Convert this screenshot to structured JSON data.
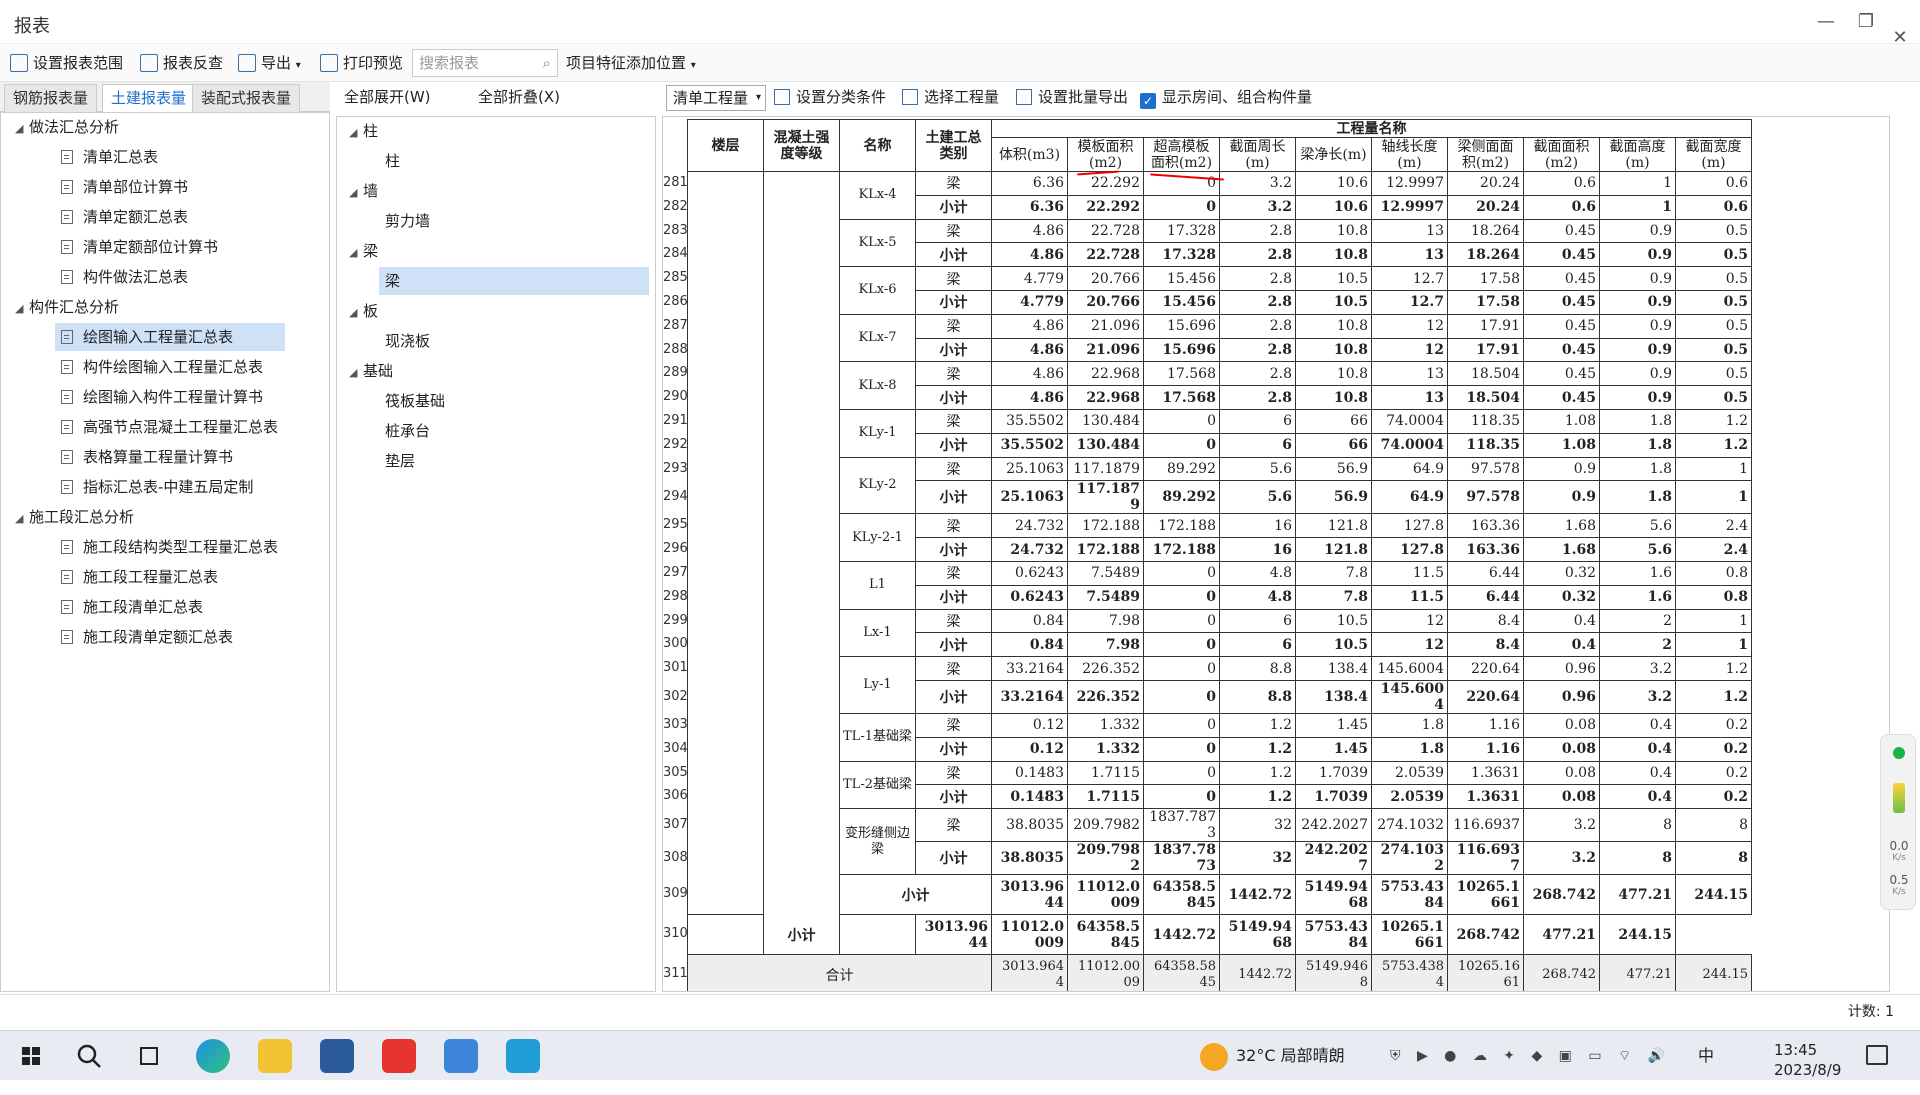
{
  "window": {
    "title": "报表",
    "min": "—",
    "restore": "❐",
    "close": "✕"
  },
  "toolbar": {
    "set_range": "设置报表范围",
    "reverse": "报表反查",
    "export": "导出",
    "print": "打印预览",
    "search_placeholder": "搜索报表",
    "feature": "项目特征添加位置"
  },
  "left_tabs": [
    "钢筋报表量",
    "土建报表量",
    "装配式报表量"
  ],
  "tree": [
    {
      "type": "group",
      "label": "做法汇总分析"
    },
    {
      "type": "item",
      "label": "清单汇总表"
    },
    {
      "type": "item",
      "label": "清单部位计算书"
    },
    {
      "type": "item",
      "label": "清单定额汇总表"
    },
    {
      "type": "item",
      "label": "清单定额部位计算书"
    },
    {
      "type": "item",
      "label": "构件做法汇总表"
    },
    {
      "type": "group",
      "label": "构件汇总分析"
    },
    {
      "type": "item",
      "label": "绘图输入工程量汇总表",
      "selected": true
    },
    {
      "type": "item",
      "label": "构件绘图输入工程量汇总表"
    },
    {
      "type": "item",
      "label": "绘图输入构件工程量计算书"
    },
    {
      "type": "item",
      "label": "高强节点混凝土工程量汇总表"
    },
    {
      "type": "item",
      "label": "表格算量工程量计算书"
    },
    {
      "type": "item",
      "label": "指标汇总表-中建五局定制"
    },
    {
      "type": "group",
      "label": "施工段汇总分析"
    },
    {
      "type": "item",
      "label": "施工段结构类型工程量汇总表"
    },
    {
      "type": "item",
      "label": "施工段工程量汇总表"
    },
    {
      "type": "item",
      "label": "施工段清单汇总表"
    },
    {
      "type": "item",
      "label": "施工段清单定额汇总表"
    }
  ],
  "mid": {
    "expand": "全部展开(W)",
    "collapse": "全部折叠(X)",
    "tree": [
      {
        "type": "group",
        "label": "柱"
      },
      {
        "type": "item",
        "label": "柱"
      },
      {
        "type": "group",
        "label": "墙"
      },
      {
        "type": "item",
        "label": "剪力墙"
      },
      {
        "type": "group",
        "label": "梁"
      },
      {
        "type": "item",
        "label": "梁",
        "selected": true
      },
      {
        "type": "group",
        "label": "板"
      },
      {
        "type": "item",
        "label": "现浇板"
      },
      {
        "type": "group",
        "label": "基础"
      },
      {
        "type": "item",
        "label": "筏板基础"
      },
      {
        "type": "item",
        "label": "桩承台"
      },
      {
        "type": "item",
        "label": "垫层"
      }
    ]
  },
  "right_toolbar": {
    "dropdown": "清单工程量",
    "classify": "设置分类条件",
    "select": "选择工程量",
    "batch": "设置批量导出",
    "show_rooms": "显示房间、组合构件量"
  },
  "table": {
    "headers": {
      "floor": "楼层",
      "grade": "混凝土强度等级",
      "name": "名称",
      "category": "土建工总类别",
      "group": "工程量名称",
      "cols": [
        "体积(m3)",
        "模板面积(m2)",
        "超高模板面积(m2)",
        "截面周长(m)",
        "梁净长(m)",
        "轴线长度(m)",
        "梁侧面面积(m2)",
        "截面面积(m2)",
        "截面高度(m)",
        "截面宽度(m)"
      ]
    },
    "rows": [
      {
        "no": "281",
        "name": "KLx-4",
        "cat": "梁",
        "v": [
          "6.36",
          "22.292",
          "0",
          "3.2",
          "10.6",
          "12.9997",
          "20.24",
          "0.6",
          "1",
          "0.6"
        ]
      },
      {
        "no": "282",
        "cat": "小计",
        "bold": true,
        "v": [
          "6.36",
          "22.292",
          "0",
          "3.2",
          "10.6",
          "12.9997",
          "20.24",
          "0.6",
          "1",
          "0.6"
        ]
      },
      {
        "no": "283",
        "name": "KLx-5",
        "cat": "梁",
        "v": [
          "4.86",
          "22.728",
          "17.328",
          "2.8",
          "10.8",
          "13",
          "18.264",
          "0.45",
          "0.9",
          "0.5"
        ]
      },
      {
        "no": "284",
        "cat": "小计",
        "bold": true,
        "v": [
          "4.86",
          "22.728",
          "17.328",
          "2.8",
          "10.8",
          "13",
          "18.264",
          "0.45",
          "0.9",
          "0.5"
        ]
      },
      {
        "no": "285",
        "name": "KLx-6",
        "cat": "梁",
        "v": [
          "4.779",
          "20.766",
          "15.456",
          "2.8",
          "10.5",
          "12.7",
          "17.58",
          "0.45",
          "0.9",
          "0.5"
        ]
      },
      {
        "no": "286",
        "cat": "小计",
        "bold": true,
        "v": [
          "4.779",
          "20.766",
          "15.456",
          "2.8",
          "10.5",
          "12.7",
          "17.58",
          "0.45",
          "0.9",
          "0.5"
        ]
      },
      {
        "no": "287",
        "name": "KLx-7",
        "cat": "梁",
        "v": [
          "4.86",
          "21.096",
          "15.696",
          "2.8",
          "10.8",
          "12",
          "17.91",
          "0.45",
          "0.9",
          "0.5"
        ]
      },
      {
        "no": "288",
        "cat": "小计",
        "bold": true,
        "v": [
          "4.86",
          "21.096",
          "15.696",
          "2.8",
          "10.8",
          "12",
          "17.91",
          "0.45",
          "0.9",
          "0.5"
        ]
      },
      {
        "no": "289",
        "name": "KLx-8",
        "cat": "梁",
        "v": [
          "4.86",
          "22.968",
          "17.568",
          "2.8",
          "10.8",
          "13",
          "18.504",
          "0.45",
          "0.9",
          "0.5"
        ]
      },
      {
        "no": "290",
        "cat": "小计",
        "bold": true,
        "v": [
          "4.86",
          "22.968",
          "17.568",
          "2.8",
          "10.8",
          "13",
          "18.504",
          "0.45",
          "0.9",
          "0.5"
        ]
      },
      {
        "no": "291",
        "name": "KLy-1",
        "cat": "梁",
        "v": [
          "35.5502",
          "130.484",
          "0",
          "6",
          "66",
          "74.0004",
          "118.35",
          "1.08",
          "1.8",
          "1.2"
        ]
      },
      {
        "no": "292",
        "cat": "小计",
        "bold": true,
        "v": [
          "35.5502",
          "130.484",
          "0",
          "6",
          "66",
          "74.0004",
          "118.35",
          "1.08",
          "1.8",
          "1.2"
        ]
      },
      {
        "no": "293",
        "name": "KLy-2",
        "cat": "梁",
        "v": [
          "25.1063",
          "117.1879",
          "89.292",
          "5.6",
          "56.9",
          "64.9",
          "97.578",
          "0.9",
          "1.8",
          "1"
        ]
      },
      {
        "no": "294",
        "cat": "小计",
        "bold": true,
        "v": [
          "25.1063",
          "117.1879",
          "89.292",
          "5.6",
          "56.9",
          "64.9",
          "97.578",
          "0.9",
          "1.8",
          "1"
        ]
      },
      {
        "no": "295",
        "name": "KLy-2-1",
        "cat": "梁",
        "v": [
          "24.732",
          "172.188",
          "172.188",
          "16",
          "121.8",
          "127.8",
          "163.36",
          "1.68",
          "5.6",
          "2.4"
        ]
      },
      {
        "no": "296",
        "cat": "小计",
        "bold": true,
        "v": [
          "24.732",
          "172.188",
          "172.188",
          "16",
          "121.8",
          "127.8",
          "163.36",
          "1.68",
          "5.6",
          "2.4"
        ]
      },
      {
        "no": "297",
        "name": "L1",
        "cat": "梁",
        "v": [
          "0.6243",
          "7.5489",
          "0",
          "4.8",
          "7.8",
          "11.5",
          "6.44",
          "0.32",
          "1.6",
          "0.8"
        ]
      },
      {
        "no": "298",
        "cat": "小计",
        "bold": true,
        "v": [
          "0.6243",
          "7.5489",
          "0",
          "4.8",
          "7.8",
          "11.5",
          "6.44",
          "0.32",
          "1.6",
          "0.8"
        ]
      },
      {
        "no": "299",
        "name": "Lx-1",
        "cat": "梁",
        "v": [
          "0.84",
          "7.98",
          "0",
          "6",
          "10.5",
          "12",
          "8.4",
          "0.4",
          "2",
          "1"
        ]
      },
      {
        "no": "300",
        "cat": "小计",
        "bold": true,
        "v": [
          "0.84",
          "7.98",
          "0",
          "6",
          "10.5",
          "12",
          "8.4",
          "0.4",
          "2",
          "1"
        ]
      },
      {
        "no": "301",
        "name": "Ly-1",
        "cat": "梁",
        "v": [
          "33.2164",
          "226.352",
          "0",
          "8.8",
          "138.4",
          "145.6004",
          "220.64",
          "0.96",
          "3.2",
          "1.2"
        ]
      },
      {
        "no": "302",
        "cat": "小计",
        "bold": true,
        "v": [
          "33.2164",
          "226.352",
          "0",
          "8.8",
          "138.4",
          "145.6004",
          "220.64",
          "0.96",
          "3.2",
          "1.2"
        ]
      },
      {
        "no": "303",
        "name": "TL-1基础梁",
        "cat": "梁",
        "v": [
          "0.12",
          "1.332",
          "0",
          "1.2",
          "1.45",
          "1.8",
          "1.16",
          "0.08",
          "0.4",
          "0.2"
        ]
      },
      {
        "no": "304",
        "cat": "小计",
        "bold": true,
        "v": [
          "0.12",
          "1.332",
          "0",
          "1.2",
          "1.45",
          "1.8",
          "1.16",
          "0.08",
          "0.4",
          "0.2"
        ]
      },
      {
        "no": "305",
        "name": "TL-2基础梁",
        "cat": "梁",
        "v": [
          "0.1483",
          "1.7115",
          "0",
          "1.2",
          "1.7039",
          "2.0539",
          "1.3631",
          "0.08",
          "0.4",
          "0.2"
        ]
      },
      {
        "no": "306",
        "cat": "小计",
        "bold": true,
        "v": [
          "0.1483",
          "1.7115",
          "0",
          "1.2",
          "1.7039",
          "2.0539",
          "1.3631",
          "0.08",
          "0.4",
          "0.2"
        ]
      },
      {
        "no": "307",
        "name": "变形缝侧边梁",
        "cat": "梁",
        "v": [
          "38.8035",
          "209.7982",
          "1837.7873",
          "32",
          "242.2027",
          "274.1032",
          "116.6937",
          "3.2",
          "8",
          "8"
        ]
      },
      {
        "no": "308",
        "cat": "小计",
        "bold": true,
        "v": [
          "38.8035",
          "209.7982",
          "1837.7873",
          "32",
          "242.2027",
          "274.1032",
          "116.6937",
          "3.2",
          "8",
          "8"
        ]
      }
    ],
    "subtotal_name": {
      "no": "309",
      "label": "小计",
      "v": [
        "3013.9644",
        "11012.0009",
        "64358.5845",
        "1442.72",
        "5149.9468",
        "5753.4384",
        "10265.1661",
        "268.742",
        "477.21",
        "244.15"
      ]
    },
    "subtotal_grade": {
      "no": "310",
      "label": "小计",
      "v": [
        "3013.9644",
        "11012.0009",
        "64358.5845",
        "1442.72",
        "5149.9468",
        "5753.4384",
        "10265.1661",
        "268.742",
        "477.21",
        "244.15"
      ]
    },
    "total": {
      "no": "311",
      "label": "合计",
      "v": [
        "3013.9644",
        "11012.0009",
        "64358.5845",
        "1442.72",
        "5149.9468",
        "5753.4384",
        "10265.1661",
        "268.742",
        "477.21",
        "244.15"
      ]
    }
  },
  "status": {
    "count": "计数: 1"
  },
  "widget": {
    "up": "0.0",
    "up_unit": "K/s",
    "down": "0.5",
    "down_unit": "K/s"
  },
  "taskbar": {
    "weather": "32°C  局部晴朗",
    "time": "13:45",
    "date": "2023/8/9",
    "ime": "中"
  }
}
